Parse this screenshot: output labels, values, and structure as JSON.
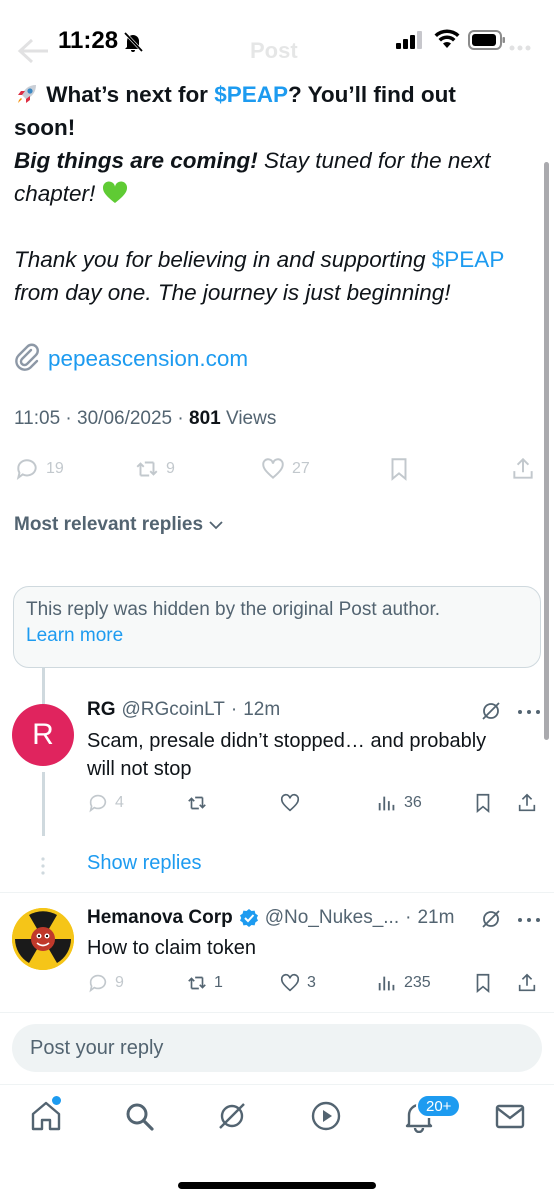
{
  "status_bar": {
    "time": "11:28"
  },
  "header": {
    "title": "Post"
  },
  "tweet": {
    "line1_prefix": "What’s next for ",
    "cashtag": "$PEAP",
    "line1_suffix": "? You’ll find out",
    "line2": "soon!",
    "line3_bold": "Big things are coming!",
    "line3_rest": " Stay tuned for the next",
    "line4": "chapter! ",
    "para2_prefix": "Thank you for believing in and supporting ",
    "para2_suffix": "from day one. The journey is just beginning!",
    "link_text": "pepeascension.com"
  },
  "meta": {
    "time": "11:05",
    "date": "30/06/2025",
    "views_count": "801",
    "views_label": "Views",
    "sep": "·"
  },
  "actions": {
    "replies": "19",
    "reposts": "9",
    "likes": "27"
  },
  "replies_filter": {
    "label": "Most relevant replies"
  },
  "hidden_notice": {
    "text": "This reply was hidden by the original Post author.",
    "learn_more": "Learn more"
  },
  "replies": [
    {
      "avatar_letter": "R",
      "name": "RG",
      "handle": "@RGcoinLT",
      "age": "12m",
      "text": "Scam, presale didn’t stopped… and probably will not stop",
      "replies": "4",
      "reposts": "",
      "likes": "",
      "views": "36"
    },
    {
      "name": "Hemanova Corp",
      "handle": "@No_Nukes_...",
      "age": "21m",
      "text": "How to claim token",
      "replies": "9",
      "reposts": "1",
      "likes": "3",
      "views": "235"
    }
  ],
  "show_replies": "Show replies",
  "composer": {
    "placeholder": "Post your reply"
  },
  "tabbar": {
    "notifications_badge": "20+"
  },
  "colors": {
    "accent": "#1d9bf0",
    "text": "#0f1419",
    "muted": "#536471",
    "avatar_r": "#e0245e"
  }
}
